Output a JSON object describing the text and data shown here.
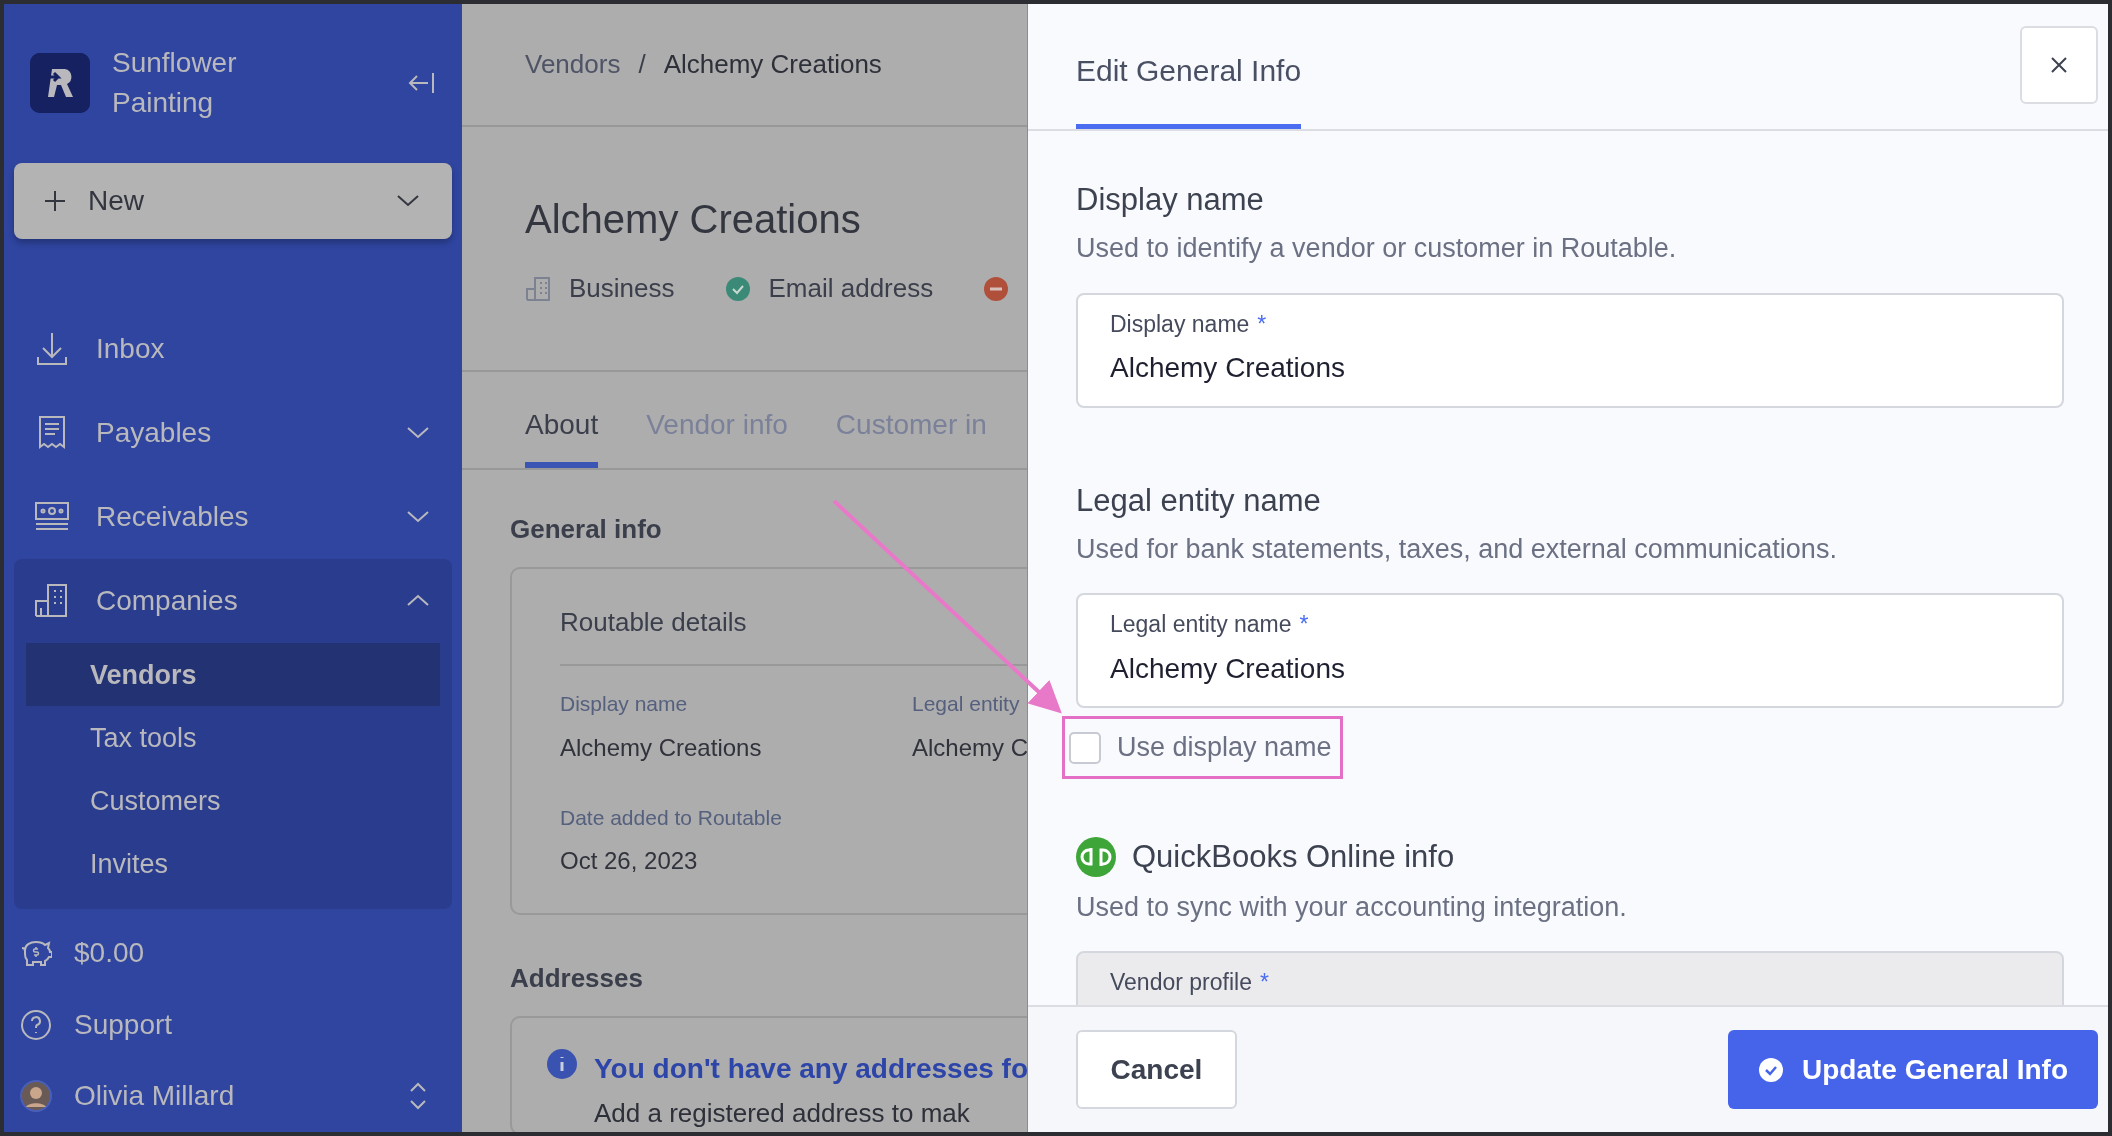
{
  "sidebar": {
    "company": "Sunflower Painting",
    "new_button": {
      "label": "New"
    },
    "nav": [
      {
        "label": "Inbox",
        "kind": "link"
      },
      {
        "label": "Payables",
        "kind": "group",
        "expanded": false
      },
      {
        "label": "Receivables",
        "kind": "group",
        "expanded": false
      },
      {
        "label": "Companies",
        "kind": "group",
        "expanded": true,
        "children": [
          {
            "label": "Vendors",
            "selected": true
          },
          {
            "label": "Tax tools",
            "selected": false
          },
          {
            "label": "Customers",
            "selected": false
          },
          {
            "label": "Invites",
            "selected": false
          }
        ]
      }
    ],
    "balance": "$0.00",
    "support": "Support",
    "user": {
      "name": "Olivia Millard"
    }
  },
  "main": {
    "breadcrumb": [
      "Vendors",
      "Alchemy Creations"
    ],
    "breadcrumb_separator": "/",
    "title": "Alchemy Creations",
    "meta": [
      {
        "kind": "business",
        "label": "Business"
      },
      {
        "kind": "verified",
        "label": "Email address"
      },
      {
        "kind": "missing"
      }
    ],
    "tabs": [
      {
        "label": "About",
        "selected": true
      },
      {
        "label": "Vendor info",
        "selected": false
      },
      {
        "label": "Customer in",
        "selected": false
      }
    ],
    "general_info": {
      "heading": "General info",
      "card_title": "Routable details",
      "fields": [
        {
          "label": "Display name",
          "value": "Alchemy Creations"
        },
        {
          "label": "Legal entity",
          "value": "Alchemy C"
        },
        {
          "label": "Date added to Routable",
          "value": "Oct 26, 2023"
        }
      ]
    },
    "addresses": {
      "heading": "Addresses",
      "alert_title": "You don't have any addresses fo",
      "alert_text": "Add a registered address to mak"
    }
  },
  "panel": {
    "title": "Edit General Info",
    "sections": [
      {
        "heading": "Display name",
        "description": "Used to identify a vendor or customer in Routable.",
        "field": {
          "label": "Display name",
          "required_mark": "*",
          "value": "Alchemy Creations",
          "disabled": false
        }
      },
      {
        "heading": "Legal entity name",
        "description": "Used for bank statements, taxes, and external communications.",
        "field": {
          "label": "Legal entity name",
          "required_mark": "*",
          "value": "Alchemy Creations",
          "disabled": false
        },
        "checkbox": {
          "label": "Use display name",
          "checked": false
        }
      },
      {
        "heading": "QuickBooks Online info",
        "kind": "integration",
        "description": "Used to sync with your accounting integration.",
        "field": {
          "label": "Vendor profile",
          "required_mark": "*",
          "disabled": true
        }
      }
    ],
    "cancel": "Cancel",
    "submit": "Update General Info"
  }
}
